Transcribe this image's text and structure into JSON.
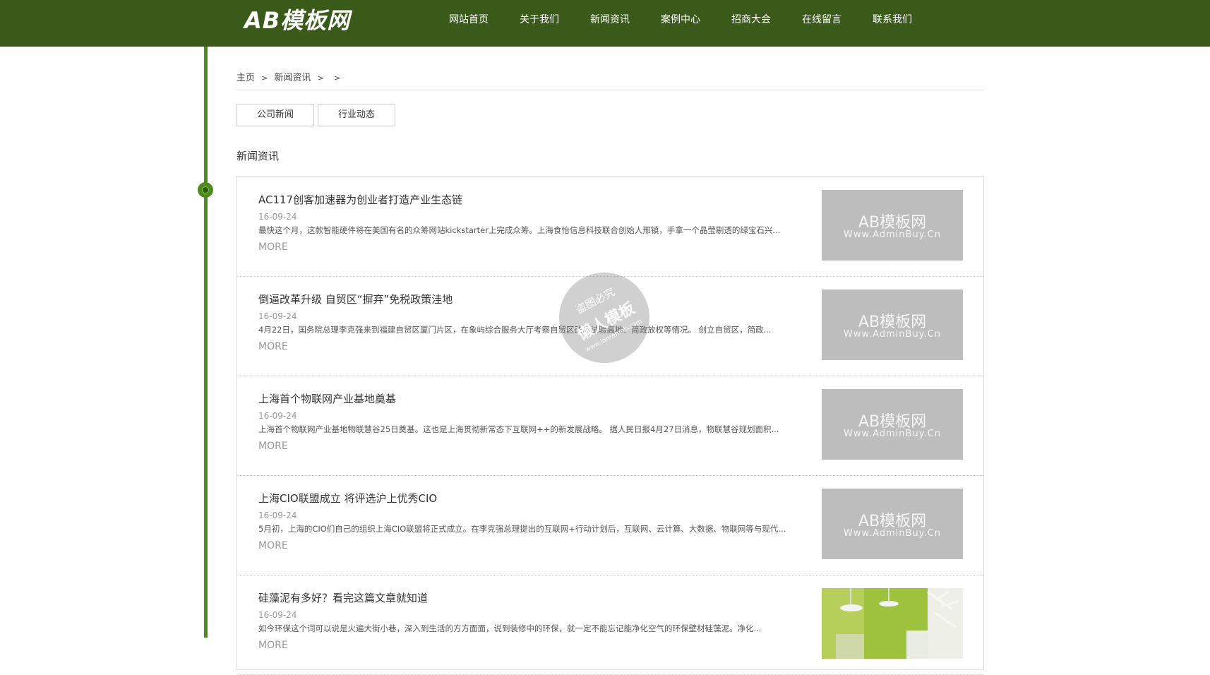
{
  "header": {
    "logo": "AB模板网",
    "nav": [
      "网站首页",
      "关于我们",
      "新闻资讯",
      "案例中心",
      "招商大会",
      "在线留言",
      "联系我们"
    ]
  },
  "breadcrumb": {
    "home": "主页",
    "sep": ">",
    "current": "新闻资讯"
  },
  "categories": [
    "公司新闻",
    "行业动态"
  ],
  "section_title": "新闻资讯",
  "thumb_text": {
    "line1": "AB模板网",
    "line2": "Www.AdminBuy.Cn"
  },
  "watermark": {
    "line1": "盗图必究",
    "line2": "懒人模板",
    "line3": "www.lanrenmb.com"
  },
  "news": [
    {
      "title": "AC117创客加速器为创业者打造产业生态链",
      "date": "16-09-24",
      "summary": "最快这个月，这款智能硬件将在美国有名的众筹网站kickstarter上完成众筹。上海食怡信息科技联合创始人邢镇，手拿一个晶莹剔透的绿宝石兴...",
      "more": "MORE"
    },
    {
      "title": "倒逼改革升级 自贸区“摒弃”免税政策洼地",
      "date": "16-09-24",
      "summary": "4月22日，国务院总理李克强来到福建自贸区厦门片区，在象屿综合服务大厅考察自贸区改革试验高地、简政放权等情况。 创立自贸区，简政...",
      "more": "MORE"
    },
    {
      "title": "上海首个物联网产业基地奠基",
      "date": "16-09-24",
      "summary": "上海首个物联网产业基地物联慧谷25日奠基。这也是上海贯彻新常态下互联网++的新发展战略。 据人民日报4月27日消息，物联慧谷规划面积...",
      "more": "MORE"
    },
    {
      "title": "上海CIO联盟成立 将评选沪上优秀CIO",
      "date": "16-09-24",
      "summary": "5月初，上海的CIO们自己的组织上海CIO联盟将正式成立。在李克强总理提出的互联网+行动计划后，互联网、云计算、大数据、物联网等与现代...",
      "more": "MORE"
    },
    {
      "title": "硅藻泥有多好？看完这篇文章就知道",
      "date": "16-09-24",
      "summary": "如今环保这个词可以说是火遍大街小巷，深入到生活的方方面面，说到装修中的环保，就一定不能忘记能净化空气的环保壁材硅藻泥。净化...",
      "more": "MORE"
    }
  ]
}
